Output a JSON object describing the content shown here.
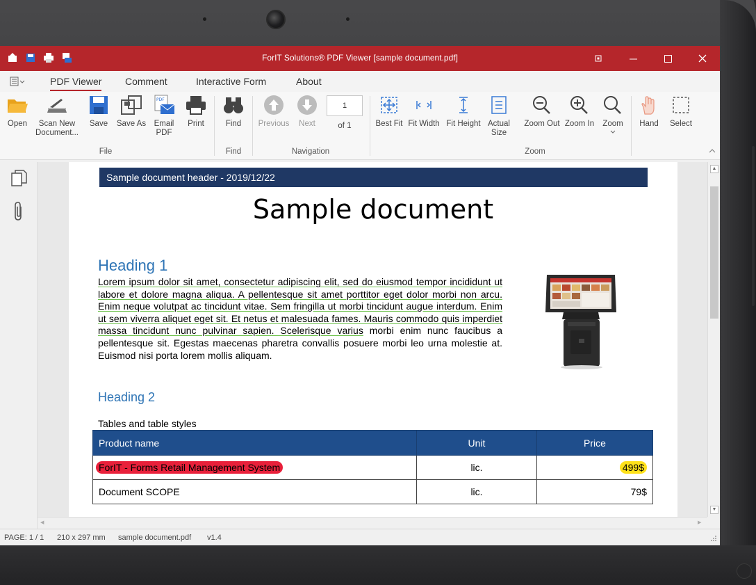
{
  "window": {
    "title": "ForIT Solutions® PDF Viewer [sample document.pdf]",
    "accent": "#b5262b"
  },
  "menu": {
    "items": [
      {
        "label": "PDF Viewer",
        "active": true
      },
      {
        "label": "Comment"
      },
      {
        "label": "Interactive Form"
      },
      {
        "label": "About"
      }
    ]
  },
  "ribbon": {
    "file": {
      "open": "Open",
      "scan": "Scan New Document...",
      "save": "Save",
      "save_as": "Save As",
      "email": "Email PDF",
      "print": "Print",
      "group": "File"
    },
    "find": {
      "find": "Find",
      "group": "Find"
    },
    "navigation": {
      "previous": "Previous",
      "next": "Next",
      "page_value": "1",
      "of_label": "of 1",
      "group": "Navigation"
    },
    "zoom": {
      "best_fit": "Best Fit",
      "fit_width": "Fit Width",
      "fit_height": "Fit Height",
      "actual_size": "Actual Size",
      "zoom_out": "Zoom Out",
      "zoom_in": "Zoom In",
      "zoom": "Zoom",
      "group": "Zoom"
    },
    "tools": {
      "hand": "Hand",
      "select": "Select"
    }
  },
  "document": {
    "header": "Sample document header - 2019/12/22",
    "title": "Sample document",
    "heading1": "Heading 1",
    "paragraph_underlined": "Lorem ipsum dolor sit amet, consectetur adipiscing elit, sed do eiusmod tempor incididunt ut labore et dolore magna aliqua. A pellentesque sit amet porttitor eget dolor morbi non arcu. Enim neque volutpat ac tincidunt vitae. Sem fringilla ut morbi tincidunt augue interdum. Enim ut sem viverra aliquet eget sit. Et netus et malesuada fames. Mauris commodo quis imperdiet massa tincidunt nunc pulvinar sapien. Scelerisque varius",
    "paragraph_rest": " morbi enim nunc faucibus a pellentesque sit. Egestas maecenas pharetra convallis posuere morbi leo urna molestie at. Euismod nisi porta lorem mollis aliquam.",
    "heading2": "Heading 2",
    "table_caption": "Tables and table styles",
    "table": {
      "headers": {
        "name": "Product name",
        "unit": "Unit",
        "price": "Price"
      },
      "rows": [
        {
          "name": "ForIT - Forms Retail Management System",
          "unit": "lic.",
          "price": "499$"
        },
        {
          "name": "Document SCOPE",
          "unit": "lic.",
          "price": "79$"
        }
      ]
    }
  },
  "status": {
    "page": "PAGE: 1 / 1",
    "size": "210 x 297 mm",
    "file": "sample document.pdf",
    "version": "v1.4"
  }
}
